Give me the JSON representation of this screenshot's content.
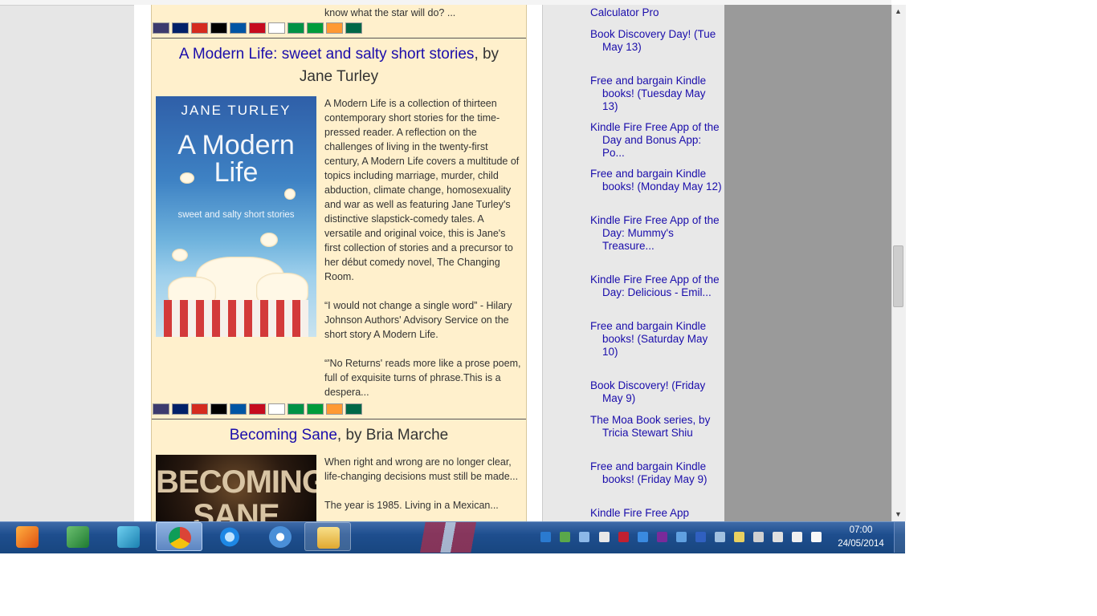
{
  "prev_book": {
    "tail_text": "know what the star will do? ..."
  },
  "book1": {
    "title_link": "A Modern Life: sweet and salty short stories",
    "title_by": ", by",
    "author": "Jane Turley",
    "cover": {
      "author": "JANE TURLEY",
      "title_line1": "A Modern",
      "title_line2": "Life",
      "subtitle": "sweet and salty short stories"
    },
    "description": "A Modern Life is a collection of thirteen contemporary short stories for the time-pressed reader. A reflection on the challenges of living in the twenty-first century, A Modern Life covers a multitude of topics including marriage, murder, child abduction, climate change, homosexuality and war as well as featuring Jane Turley's distinctive slapstick-comedy tales. A versatile and original voice, this is Jane's first collection of stories and a precursor to her début comedy novel, The Changing Room.\n\n“I would not change a single word” - Hilary Johnson Authors' Advisory Service on the short story A Modern Life.\n\n“'No Returns' reads more like a prose poem, full of exquisite turns of phrase.This is a despera..."
  },
  "book2": {
    "title_link": "Becoming Sane",
    "title_by": ", by Bria Marche",
    "cover": {
      "line1": "BECOMING",
      "line2": "SANE"
    },
    "description": "When right and wrong are no longer clear, life-changing decisions must still be made...\n\nThe year is 1985. Living in a Mexican..."
  },
  "flags": [
    "us-flag",
    "uk-flag",
    "canada-flag",
    "germany-flag",
    "france-flag",
    "spain-flag",
    "japan-flag",
    "italy-flag",
    "brazil-flag",
    "india-flag",
    "mexico-flag"
  ],
  "flag_colors": {
    "us-flag": "#3c3b6e",
    "uk-flag": "#012169",
    "canada-flag": "#d52b1e",
    "germany-flag": "#000000",
    "france-flag": "#0055a4",
    "spain-flag": "#c60b1e",
    "japan-flag": "#ffffff",
    "italy-flag": "#009246",
    "brazil-flag": "#009c3b",
    "india-flag": "#ff9933",
    "mexico-flag": "#006847"
  },
  "sidebar": {
    "items": [
      "Calculator Pro",
      "Book Discovery Day! (Tue May 13)",
      "Free and bargain Kindle books! (Tuesday May 13)",
      "Kindle Fire Free App of the Day and Bonus App: Po...",
      "Free and bargain Kindle books! (Monday May 12)",
      "Kindle Fire Free App of the Day: Mummy's Treasure...",
      "Kindle Fire Free App of the Day: Delicious - Emil...",
      "Free and bargain Kindle books! (Saturday May 10)",
      "Book Discovery! (Friday May 9)",
      "The Moa Book series, by Tricia Stewart Shiu",
      "Free and bargain Kindle books! (Friday May 9)",
      "Kindle Fire Free App"
    ]
  },
  "taskbar": {
    "apps": [
      "media-player-icon",
      "excel-icon",
      "help-icon",
      "chrome-icon",
      "internet-explorer-icon",
      "network-tool-icon",
      "explorer-folder-icon"
    ],
    "clock_time": "07:00",
    "clock_date": "24/05/2014"
  },
  "colors": {
    "link": "#1a0dab",
    "content_bg": "#fff0cc",
    "sidebar_bg": "#e8e8e8",
    "taskbar": "#1e4e8e"
  }
}
